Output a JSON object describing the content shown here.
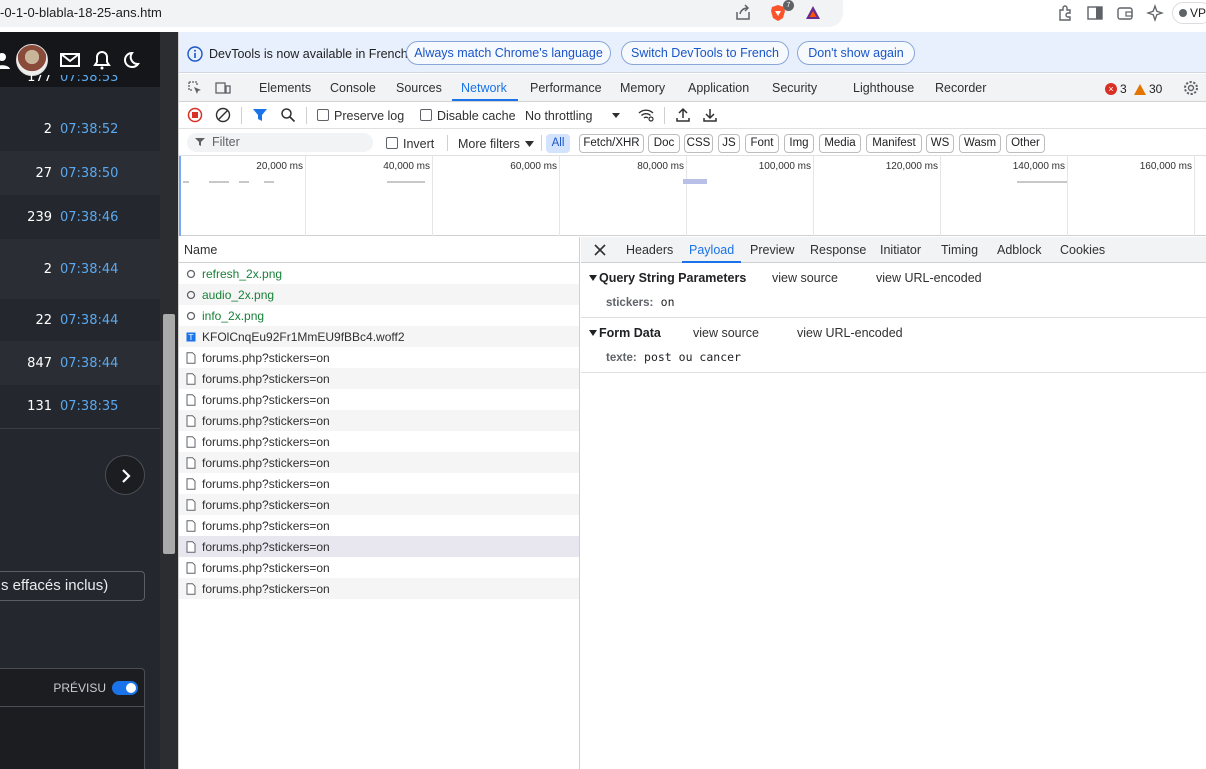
{
  "browser": {
    "url": "-0-1-0-blabla-18-25-ans.htm",
    "extension_badge": "7",
    "vpn_label": "VPN"
  },
  "page": {
    "rows": [
      {
        "count": "177",
        "time": "07:38:53"
      },
      {
        "count": "2",
        "time": "07:38:52"
      },
      {
        "count": "27",
        "time": "07:38:50"
      },
      {
        "count": "239",
        "time": "07:38:46"
      },
      {
        "count": "2",
        "time": "07:38:44"
      },
      {
        "count": "22",
        "time": "07:38:44"
      },
      {
        "count": "847",
        "time": "07:38:44"
      },
      {
        "count": "131",
        "time": "07:38:35"
      }
    ],
    "deleted_box": "s effacés inclus)",
    "preview_label": "PRÉVISU"
  },
  "devtools": {
    "infobar": {
      "message": "DevTools is now available in French!",
      "btn_match": "Always match Chrome's language",
      "btn_switch": "Switch DevTools to French",
      "btn_dismiss": "Don't show again"
    },
    "tabs": [
      "Elements",
      "Console",
      "Sources",
      "Network",
      "Performance",
      "Memory",
      "Application",
      "Security",
      "Lighthouse",
      "Recorder"
    ],
    "active_tab": "Network",
    "errors": "3",
    "warnings": "30",
    "network": {
      "preserve_log": "Preserve log",
      "disable_cache": "Disable cache",
      "throttling": "No throttling"
    },
    "filter": {
      "placeholder": "Filter",
      "invert": "Invert",
      "more_filters": "More filters",
      "types": [
        "All",
        "Fetch/XHR",
        "Doc",
        "CSS",
        "JS",
        "Font",
        "Img",
        "Media",
        "Manifest",
        "WS",
        "Wasm",
        "Other"
      ]
    },
    "overview_ticks": [
      "20,000 ms",
      "40,000 ms",
      "60,000 ms",
      "80,000 ms",
      "100,000 ms",
      "120,000 ms",
      "140,000 ms",
      "160,000 ms"
    ],
    "requests_header": "Name",
    "requests": [
      {
        "name": "refresh_2x.png",
        "type": "img"
      },
      {
        "name": "audio_2x.png",
        "type": "img"
      },
      {
        "name": "info_2x.png",
        "type": "img"
      },
      {
        "name": "KFOlCnqEu92Fr1MmEU9fBBc4.woff2",
        "type": "font"
      },
      {
        "name": "forums.php?stickers=on",
        "type": "doc"
      },
      {
        "name": "forums.php?stickers=on",
        "type": "doc"
      },
      {
        "name": "forums.php?stickers=on",
        "type": "doc"
      },
      {
        "name": "forums.php?stickers=on",
        "type": "doc"
      },
      {
        "name": "forums.php?stickers=on",
        "type": "doc"
      },
      {
        "name": "forums.php?stickers=on",
        "type": "doc"
      },
      {
        "name": "forums.php?stickers=on",
        "type": "doc"
      },
      {
        "name": "forums.php?stickers=on",
        "type": "doc"
      },
      {
        "name": "forums.php?stickers=on",
        "type": "doc"
      },
      {
        "name": "forums.php?stickers=on",
        "type": "doc"
      },
      {
        "name": "forums.php?stickers=on",
        "type": "doc"
      },
      {
        "name": "forums.php?stickers=on",
        "type": "doc"
      }
    ],
    "detail_tabs": [
      "Headers",
      "Payload",
      "Preview",
      "Response",
      "Initiator",
      "Timing",
      "Adblock",
      "Cookies"
    ],
    "active_detail_tab": "Payload",
    "payload": {
      "query_title": "Query String Parameters",
      "form_title": "Form Data",
      "view_source": "view source",
      "view_url_encoded": "view URL-encoded",
      "query_key": "stickers:",
      "query_value": "on",
      "form_key": "texte:",
      "form_value": "post ou cancer"
    }
  }
}
